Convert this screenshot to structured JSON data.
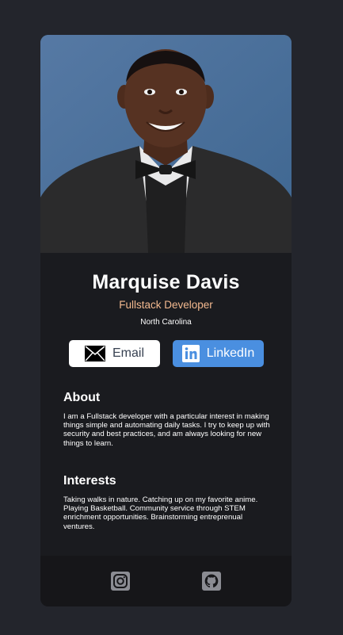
{
  "profile": {
    "name": "Marquise Davis",
    "title": "Fullstack Developer",
    "location": "North Carolina"
  },
  "buttons": {
    "email_label": "Email",
    "linkedin_label": "LinkedIn"
  },
  "about": {
    "heading": "About",
    "text": "I am a Fullstack developer with a particular interest in making things simple and automating daily tasks. I try to keep up with security and best practices, and am always looking for new things to learn."
  },
  "interests": {
    "heading": "Interests",
    "text": "Taking walks in nature. Catching up on my favorite anime. Playing Basketball. Community service through STEM enrichment opportunities. Brainstorming entreprenual ventures."
  },
  "footer": {
    "icons": [
      "instagram-icon",
      "github-icon"
    ]
  },
  "colors": {
    "page_bg": "#23252c",
    "card_bg": "#1a1b1f",
    "footer_bg": "#161619",
    "accent_title": "#f3b98f",
    "linkedin_blue": "#4a8fe0",
    "icon_gray": "#8b8c93"
  }
}
